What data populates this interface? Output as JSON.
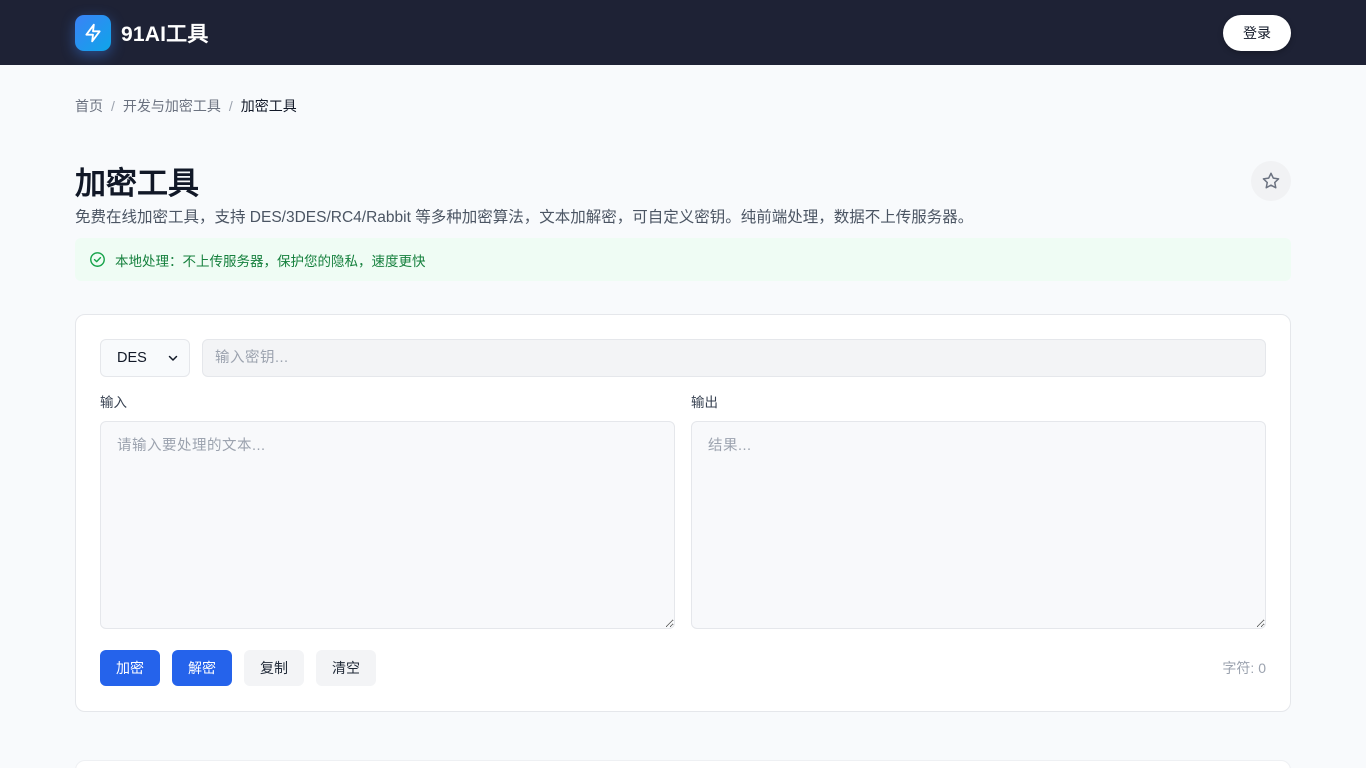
{
  "header": {
    "brand": "91AI工具",
    "login_label": "登录",
    "logo_icon": "bolt-icon"
  },
  "breadcrumb": {
    "items": [
      "首页",
      "开发与加密工具",
      "加密工具"
    ],
    "separator": "/"
  },
  "page": {
    "title": "加密工具",
    "description": "免费在线加密工具，支持 DES/3DES/RC4/Rabbit 等多种加密算法，文本加解密，可自定义密钥。纯前端处理，数据不上传服务器。",
    "notice": "本地处理：不上传服务器，保护您的隐私，速度更快",
    "favorite_icon": "star-icon"
  },
  "tool": {
    "algorithm": "DES",
    "algorithm_options": [
      "DES"
    ],
    "key_placeholder": "输入密钥...",
    "key_value": "",
    "input_label": "输入",
    "input_placeholder": "请输入要处理的文本...",
    "output_label": "输出",
    "output_placeholder": "结果...",
    "buttons": {
      "encrypt": "加密",
      "decrypt": "解密",
      "copy": "复制",
      "clear": "清空"
    },
    "char_count": "字符: 0"
  },
  "colors": {
    "header_bg": "#1e2235",
    "primary": "#2563eb",
    "notice_text": "#15803d",
    "notice_bg": "#effcf4"
  }
}
